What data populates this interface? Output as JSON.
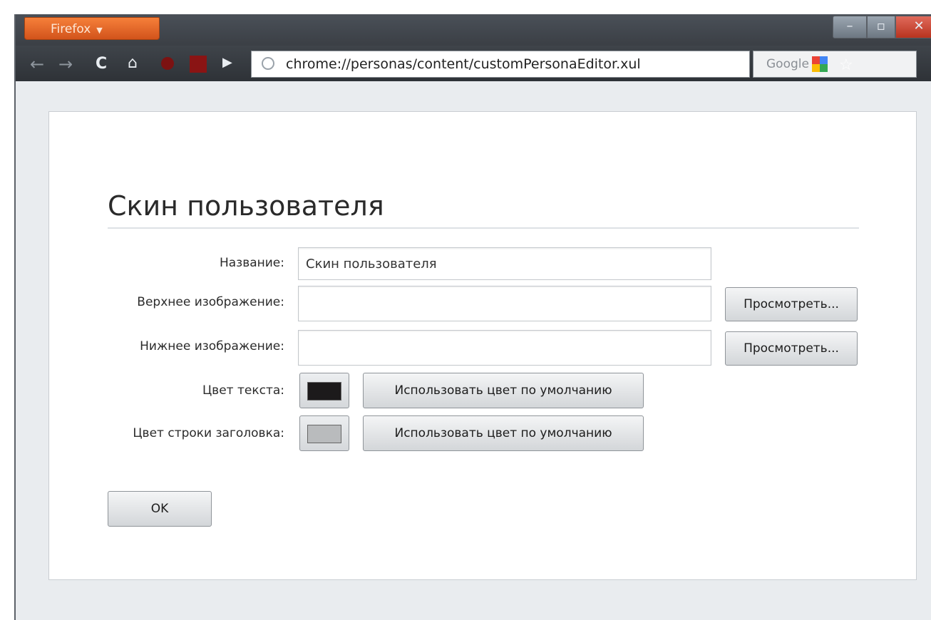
{
  "browser": {
    "app_menu_label": "Firefox",
    "url": "chrome://personas/content/customPersonaEditor.xul",
    "search_placeholder": "Google"
  },
  "editor": {
    "title": "Скин пользователя",
    "fields": {
      "name_label": "Название:",
      "name_value": "Скин пользователя",
      "header_label": "Верхнее изображение:",
      "header_value": "",
      "footer_label": "Нижнее изображение:",
      "footer_value": "",
      "browse_label": "Просмотреть...",
      "text_color_label": "Цвет текста:",
      "titlebar_color_label": "Цвет строки заголовка:",
      "use_default_label": "Использовать цвет по умолчанию"
    },
    "colors": {
      "text_color": "#1c1a1b",
      "titlebar_color": "#b9bbbd"
    },
    "ok_label": "OK"
  }
}
